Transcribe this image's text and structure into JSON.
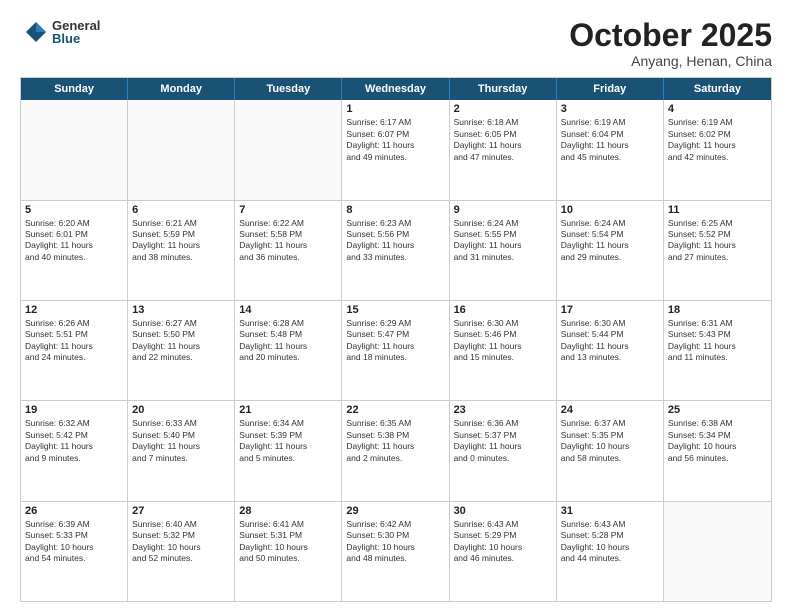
{
  "header": {
    "logo_general": "General",
    "logo_blue": "Blue",
    "month_title": "October 2025",
    "subtitle": "Anyang, Henan, China"
  },
  "weekdays": [
    "Sunday",
    "Monday",
    "Tuesday",
    "Wednesday",
    "Thursday",
    "Friday",
    "Saturday"
  ],
  "rows": [
    [
      {
        "day": "",
        "empty": true
      },
      {
        "day": "",
        "empty": true
      },
      {
        "day": "",
        "empty": true
      },
      {
        "day": "1",
        "lines": [
          "Sunrise: 6:17 AM",
          "Sunset: 6:07 PM",
          "Daylight: 11 hours",
          "and 49 minutes."
        ]
      },
      {
        "day": "2",
        "lines": [
          "Sunrise: 6:18 AM",
          "Sunset: 6:05 PM",
          "Daylight: 11 hours",
          "and 47 minutes."
        ]
      },
      {
        "day": "3",
        "lines": [
          "Sunrise: 6:19 AM",
          "Sunset: 6:04 PM",
          "Daylight: 11 hours",
          "and 45 minutes."
        ]
      },
      {
        "day": "4",
        "lines": [
          "Sunrise: 6:19 AM",
          "Sunset: 6:02 PM",
          "Daylight: 11 hours",
          "and 42 minutes."
        ]
      }
    ],
    [
      {
        "day": "5",
        "lines": [
          "Sunrise: 6:20 AM",
          "Sunset: 6:01 PM",
          "Daylight: 11 hours",
          "and 40 minutes."
        ]
      },
      {
        "day": "6",
        "lines": [
          "Sunrise: 6:21 AM",
          "Sunset: 5:59 PM",
          "Daylight: 11 hours",
          "and 38 minutes."
        ]
      },
      {
        "day": "7",
        "lines": [
          "Sunrise: 6:22 AM",
          "Sunset: 5:58 PM",
          "Daylight: 11 hours",
          "and 36 minutes."
        ]
      },
      {
        "day": "8",
        "lines": [
          "Sunrise: 6:23 AM",
          "Sunset: 5:56 PM",
          "Daylight: 11 hours",
          "and 33 minutes."
        ]
      },
      {
        "day": "9",
        "lines": [
          "Sunrise: 6:24 AM",
          "Sunset: 5:55 PM",
          "Daylight: 11 hours",
          "and 31 minutes."
        ]
      },
      {
        "day": "10",
        "lines": [
          "Sunrise: 6:24 AM",
          "Sunset: 5:54 PM",
          "Daylight: 11 hours",
          "and 29 minutes."
        ]
      },
      {
        "day": "11",
        "lines": [
          "Sunrise: 6:25 AM",
          "Sunset: 5:52 PM",
          "Daylight: 11 hours",
          "and 27 minutes."
        ]
      }
    ],
    [
      {
        "day": "12",
        "lines": [
          "Sunrise: 6:26 AM",
          "Sunset: 5:51 PM",
          "Daylight: 11 hours",
          "and 24 minutes."
        ]
      },
      {
        "day": "13",
        "lines": [
          "Sunrise: 6:27 AM",
          "Sunset: 5:50 PM",
          "Daylight: 11 hours",
          "and 22 minutes."
        ]
      },
      {
        "day": "14",
        "lines": [
          "Sunrise: 6:28 AM",
          "Sunset: 5:48 PM",
          "Daylight: 11 hours",
          "and 20 minutes."
        ]
      },
      {
        "day": "15",
        "lines": [
          "Sunrise: 6:29 AM",
          "Sunset: 5:47 PM",
          "Daylight: 11 hours",
          "and 18 minutes."
        ]
      },
      {
        "day": "16",
        "lines": [
          "Sunrise: 6:30 AM",
          "Sunset: 5:46 PM",
          "Daylight: 11 hours",
          "and 15 minutes."
        ]
      },
      {
        "day": "17",
        "lines": [
          "Sunrise: 6:30 AM",
          "Sunset: 5:44 PM",
          "Daylight: 11 hours",
          "and 13 minutes."
        ]
      },
      {
        "day": "18",
        "lines": [
          "Sunrise: 6:31 AM",
          "Sunset: 5:43 PM",
          "Daylight: 11 hours",
          "and 11 minutes."
        ]
      }
    ],
    [
      {
        "day": "19",
        "lines": [
          "Sunrise: 6:32 AM",
          "Sunset: 5:42 PM",
          "Daylight: 11 hours",
          "and 9 minutes."
        ]
      },
      {
        "day": "20",
        "lines": [
          "Sunrise: 6:33 AM",
          "Sunset: 5:40 PM",
          "Daylight: 11 hours",
          "and 7 minutes."
        ]
      },
      {
        "day": "21",
        "lines": [
          "Sunrise: 6:34 AM",
          "Sunset: 5:39 PM",
          "Daylight: 11 hours",
          "and 5 minutes."
        ]
      },
      {
        "day": "22",
        "lines": [
          "Sunrise: 6:35 AM",
          "Sunset: 5:38 PM",
          "Daylight: 11 hours",
          "and 2 minutes."
        ]
      },
      {
        "day": "23",
        "lines": [
          "Sunrise: 6:36 AM",
          "Sunset: 5:37 PM",
          "Daylight: 11 hours",
          "and 0 minutes."
        ]
      },
      {
        "day": "24",
        "lines": [
          "Sunrise: 6:37 AM",
          "Sunset: 5:35 PM",
          "Daylight: 10 hours",
          "and 58 minutes."
        ]
      },
      {
        "day": "25",
        "lines": [
          "Sunrise: 6:38 AM",
          "Sunset: 5:34 PM",
          "Daylight: 10 hours",
          "and 56 minutes."
        ]
      }
    ],
    [
      {
        "day": "26",
        "lines": [
          "Sunrise: 6:39 AM",
          "Sunset: 5:33 PM",
          "Daylight: 10 hours",
          "and 54 minutes."
        ]
      },
      {
        "day": "27",
        "lines": [
          "Sunrise: 6:40 AM",
          "Sunset: 5:32 PM",
          "Daylight: 10 hours",
          "and 52 minutes."
        ]
      },
      {
        "day": "28",
        "lines": [
          "Sunrise: 6:41 AM",
          "Sunset: 5:31 PM",
          "Daylight: 10 hours",
          "and 50 minutes."
        ]
      },
      {
        "day": "29",
        "lines": [
          "Sunrise: 6:42 AM",
          "Sunset: 5:30 PM",
          "Daylight: 10 hours",
          "and 48 minutes."
        ]
      },
      {
        "day": "30",
        "lines": [
          "Sunrise: 6:43 AM",
          "Sunset: 5:29 PM",
          "Daylight: 10 hours",
          "and 46 minutes."
        ]
      },
      {
        "day": "31",
        "lines": [
          "Sunrise: 6:43 AM",
          "Sunset: 5:28 PM",
          "Daylight: 10 hours",
          "and 44 minutes."
        ]
      },
      {
        "day": "",
        "empty": true
      }
    ]
  ]
}
